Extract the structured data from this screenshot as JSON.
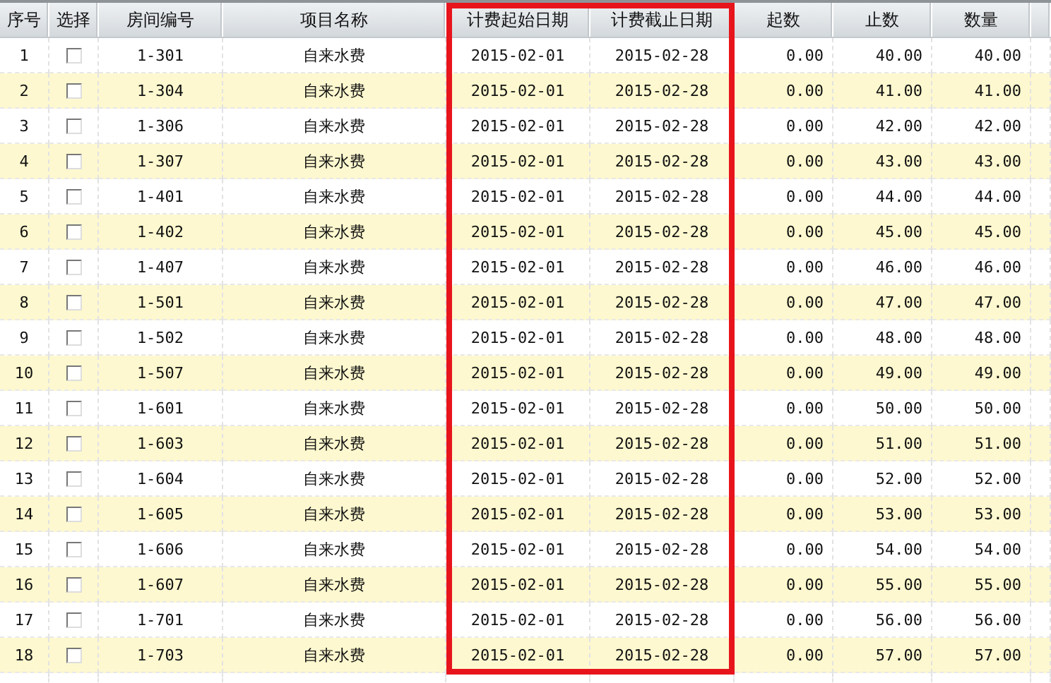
{
  "table": {
    "columns": [
      {
        "label": "序号",
        "highlighted": false
      },
      {
        "label": "选择",
        "highlighted": false
      },
      {
        "label": "房间编号",
        "highlighted": false
      },
      {
        "label": "项目名称",
        "highlighted": false
      },
      {
        "label": "计费起始日期",
        "highlighted": true
      },
      {
        "label": "计费截止日期",
        "highlighted": true
      },
      {
        "label": "起数",
        "highlighted": false
      },
      {
        "label": "止数",
        "highlighted": false
      },
      {
        "label": "数量",
        "highlighted": false
      }
    ],
    "rows": [
      {
        "no": "1",
        "checked": false,
        "room": "1-301",
        "item": "自来水费",
        "start_date": "2015-02-01",
        "end_date": "2015-02-28",
        "start_reading": "0.00",
        "end_reading": "40.00",
        "quantity": "40.00"
      },
      {
        "no": "2",
        "checked": false,
        "room": "1-304",
        "item": "自来水费",
        "start_date": "2015-02-01",
        "end_date": "2015-02-28",
        "start_reading": "0.00",
        "end_reading": "41.00",
        "quantity": "41.00"
      },
      {
        "no": "3",
        "checked": false,
        "room": "1-306",
        "item": "自来水费",
        "start_date": "2015-02-01",
        "end_date": "2015-02-28",
        "start_reading": "0.00",
        "end_reading": "42.00",
        "quantity": "42.00"
      },
      {
        "no": "4",
        "checked": false,
        "room": "1-307",
        "item": "自来水费",
        "start_date": "2015-02-01",
        "end_date": "2015-02-28",
        "start_reading": "0.00",
        "end_reading": "43.00",
        "quantity": "43.00"
      },
      {
        "no": "5",
        "checked": false,
        "room": "1-401",
        "item": "自来水费",
        "start_date": "2015-02-01",
        "end_date": "2015-02-28",
        "start_reading": "0.00",
        "end_reading": "44.00",
        "quantity": "44.00"
      },
      {
        "no": "6",
        "checked": false,
        "room": "1-402",
        "item": "自来水费",
        "start_date": "2015-02-01",
        "end_date": "2015-02-28",
        "start_reading": "0.00",
        "end_reading": "45.00",
        "quantity": "45.00"
      },
      {
        "no": "7",
        "checked": false,
        "room": "1-407",
        "item": "自来水费",
        "start_date": "2015-02-01",
        "end_date": "2015-02-28",
        "start_reading": "0.00",
        "end_reading": "46.00",
        "quantity": "46.00"
      },
      {
        "no": "8",
        "checked": false,
        "room": "1-501",
        "item": "自来水费",
        "start_date": "2015-02-01",
        "end_date": "2015-02-28",
        "start_reading": "0.00",
        "end_reading": "47.00",
        "quantity": "47.00"
      },
      {
        "no": "9",
        "checked": false,
        "room": "1-502",
        "item": "自来水费",
        "start_date": "2015-02-01",
        "end_date": "2015-02-28",
        "start_reading": "0.00",
        "end_reading": "48.00",
        "quantity": "48.00"
      },
      {
        "no": "10",
        "checked": false,
        "room": "1-507",
        "item": "自来水费",
        "start_date": "2015-02-01",
        "end_date": "2015-02-28",
        "start_reading": "0.00",
        "end_reading": "49.00",
        "quantity": "49.00"
      },
      {
        "no": "11",
        "checked": false,
        "room": "1-601",
        "item": "自来水费",
        "start_date": "2015-02-01",
        "end_date": "2015-02-28",
        "start_reading": "0.00",
        "end_reading": "50.00",
        "quantity": "50.00"
      },
      {
        "no": "12",
        "checked": false,
        "room": "1-603",
        "item": "自来水费",
        "start_date": "2015-02-01",
        "end_date": "2015-02-28",
        "start_reading": "0.00",
        "end_reading": "51.00",
        "quantity": "51.00"
      },
      {
        "no": "13",
        "checked": false,
        "room": "1-604",
        "item": "自来水费",
        "start_date": "2015-02-01",
        "end_date": "2015-02-28",
        "start_reading": "0.00",
        "end_reading": "52.00",
        "quantity": "52.00"
      },
      {
        "no": "14",
        "checked": false,
        "room": "1-605",
        "item": "自来水费",
        "start_date": "2015-02-01",
        "end_date": "2015-02-28",
        "start_reading": "0.00",
        "end_reading": "53.00",
        "quantity": "53.00"
      },
      {
        "no": "15",
        "checked": false,
        "room": "1-606",
        "item": "自来水费",
        "start_date": "2015-02-01",
        "end_date": "2015-02-28",
        "start_reading": "0.00",
        "end_reading": "54.00",
        "quantity": "54.00"
      },
      {
        "no": "16",
        "checked": false,
        "room": "1-607",
        "item": "自来水费",
        "start_date": "2015-02-01",
        "end_date": "2015-02-28",
        "start_reading": "0.00",
        "end_reading": "55.00",
        "quantity": "55.00"
      },
      {
        "no": "17",
        "checked": false,
        "room": "1-701",
        "item": "自来水费",
        "start_date": "2015-02-01",
        "end_date": "2015-02-28",
        "start_reading": "0.00",
        "end_reading": "56.00",
        "quantity": "56.00"
      },
      {
        "no": "18",
        "checked": false,
        "room": "1-703",
        "item": "自来水费",
        "start_date": "2015-02-01",
        "end_date": "2015-02-28",
        "start_reading": "0.00",
        "end_reading": "57.00",
        "quantity": "57.00"
      }
    ]
  }
}
